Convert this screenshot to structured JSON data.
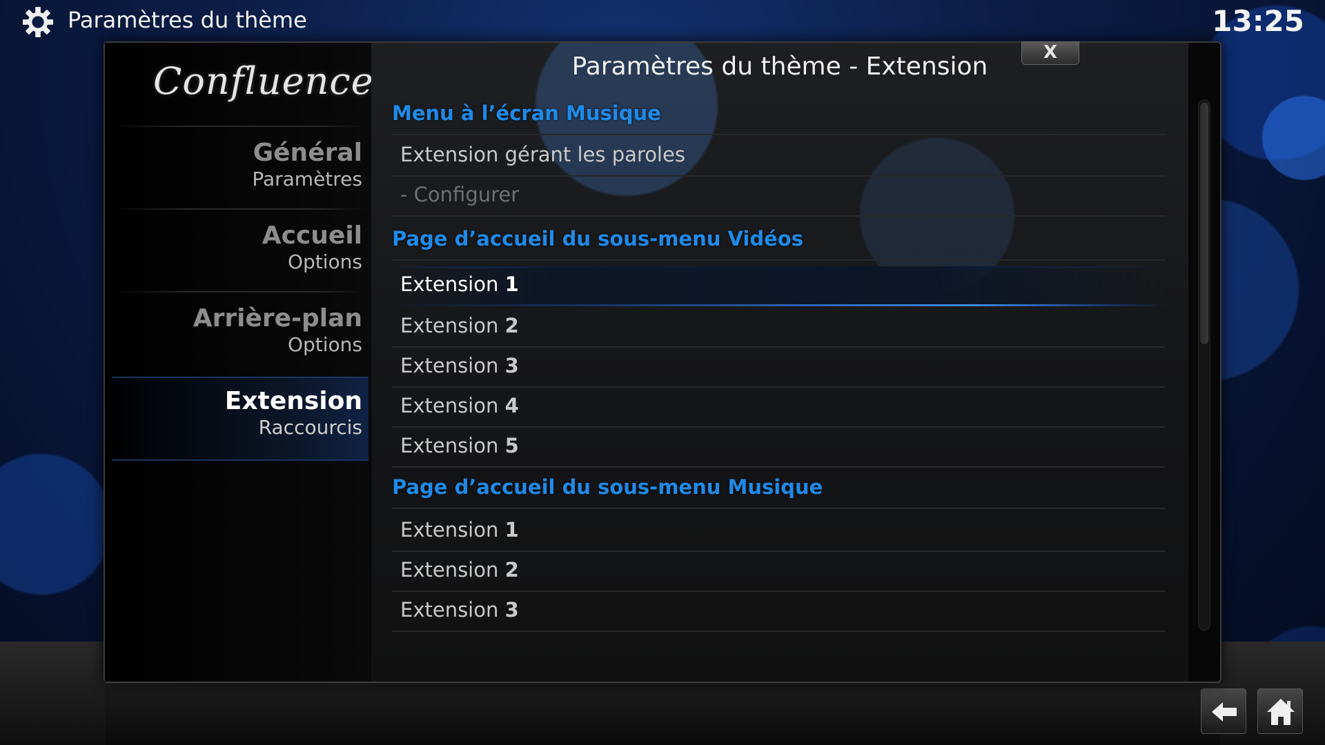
{
  "header": {
    "title": "Paramètres du thème",
    "clock": "13:25",
    "icon": "gear-icon"
  },
  "sidebar": {
    "logo": "Confluence",
    "items": [
      {
        "main": "Général",
        "sub": "Paramètres",
        "active": false
      },
      {
        "main": "Accueil",
        "sub": "Options",
        "active": false
      },
      {
        "main": "Arrière-plan",
        "sub": "Options",
        "active": false
      },
      {
        "main": "Extension",
        "sub": "Raccourcis",
        "active": true
      }
    ]
  },
  "dialog": {
    "title": "Paramètres du thème - Extension",
    "close_label": "X"
  },
  "list": {
    "section1": {
      "header": "Menu à l’écran Musique",
      "item1": "Extension gérant les paroles",
      "item2": "- Configurer"
    },
    "section2": {
      "header": "Page d’accueil du sous-menu Vidéos",
      "items": [
        {
          "label": "Extension",
          "num": "1"
        },
        {
          "label": "Extension",
          "num": "2"
        },
        {
          "label": "Extension",
          "num": "3"
        },
        {
          "label": "Extension",
          "num": "4"
        },
        {
          "label": "Extension",
          "num": "5"
        }
      ]
    },
    "section3": {
      "header": "Page d’accueil du sous-menu Musique",
      "items": [
        {
          "label": "Extension",
          "num": "1"
        },
        {
          "label": "Extension",
          "num": "2"
        },
        {
          "label": "Extension",
          "num": "3"
        }
      ]
    }
  },
  "footer": {
    "back_icon": "back-arrow-icon",
    "home_icon": "home-icon"
  },
  "colors": {
    "accent": "#1f8ae8",
    "focus": "#3f8cf0"
  }
}
